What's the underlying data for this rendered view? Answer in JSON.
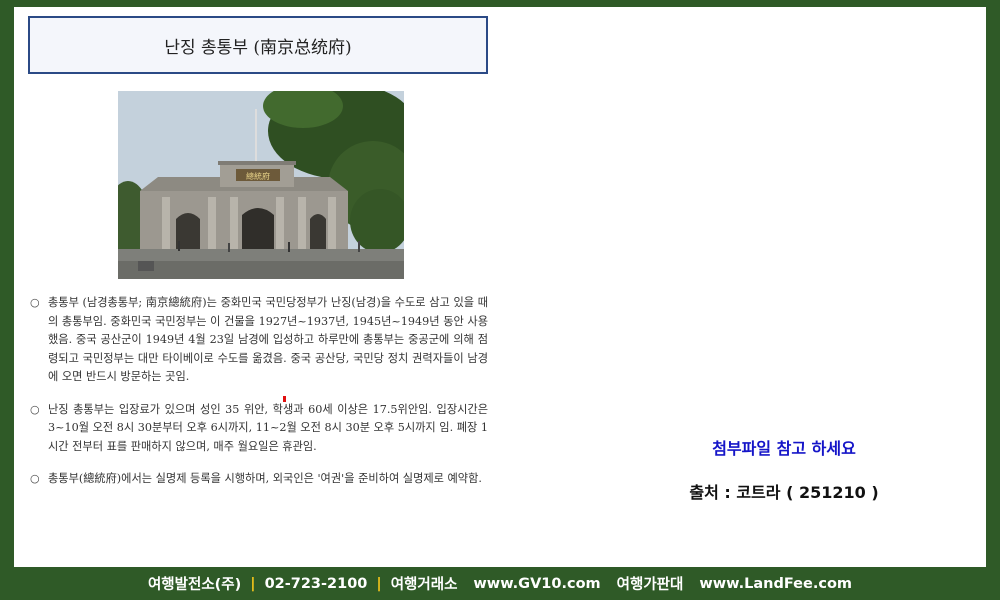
{
  "title": "난징 총통부 (南京总统府)",
  "photo_icon": "nanjing-presidential-palace-photo",
  "bullet_marker": "○",
  "bullets": [
    "총통부 (남경총통부; 南京總統府)는 중화민국 국민당정부가 난징(남경)을 수도로 삼고 있을 때의 총통부임. 중화민국 국민정부는 이 건물을 1927년~1937년, 1945년~1949년 동안 사용했음. 중국 공산군이 1949년 4월 23일 남경에 입성하고 하루만에 총통부는 중공군에 의해 점령되고 국민정부는 대만 타이베이로 수도를 옮겼음. 중국 공산당, 국민당 정치 권력자들이 남경에 오면 반드시 방문하는 곳임.",
    "난징 총통부는 입장료가 있으며 성인 35 위안, 학생과 60세 이상은 17.5위안임. 입장시간은 3~10월 오전 8시 30분부터 오후 6시까지, 11~2월 오전 8시 30분 오후 5시까지 임. 폐장 1시간 전부터 표를 판매하지 않으며, 매주 월요일은 휴관임.",
    "총통부(總統府)에서는 실명제 등록을 시행하며, 외국인은 '여권'을 준비하여 실명제로 예약함."
  ],
  "attachment_note": "첨부파일 참고 하세요",
  "source_note": "출처 : 코트라 ( 251210 )",
  "footer": {
    "company": "여행발전소(주)",
    "phone": "02-723-2100",
    "exchange_label": "여행거래소",
    "exchange_url": "www.GV10.com",
    "sales_label": "여행가판대",
    "sales_url": "www.LandFee.com",
    "separator": "|"
  },
  "colors": {
    "background": "#2f5a27",
    "title_border": "#2b4a86",
    "attachment_text": "#1515c8",
    "footer_separator": "#f2c41a"
  }
}
